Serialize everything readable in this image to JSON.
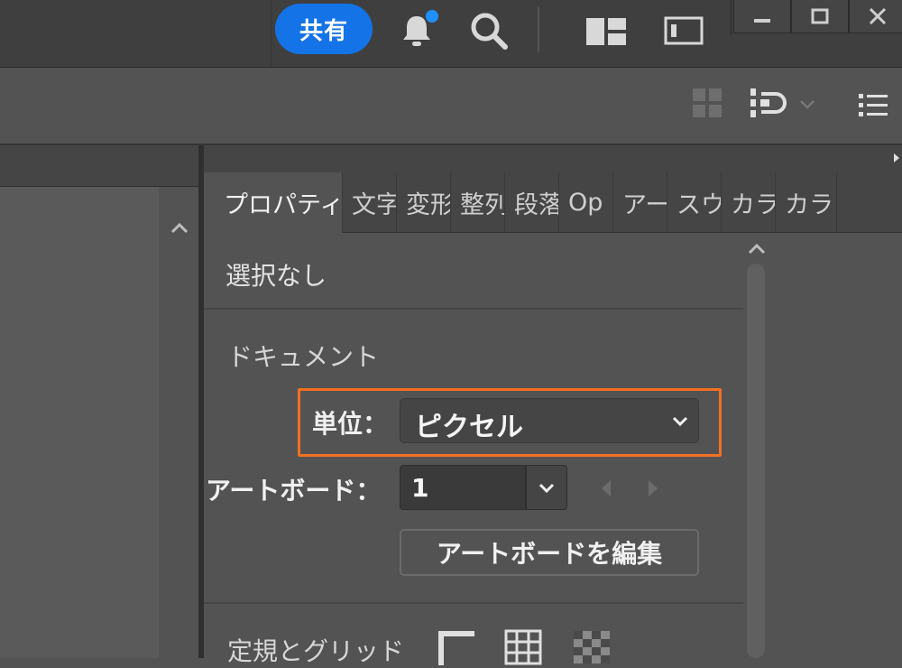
{
  "titlebar": {
    "share_label": "共有",
    "icons": [
      "bell-icon",
      "search-icon",
      "workspace-layout-icon",
      "panel-toggle-icon"
    ],
    "window_controls": [
      "minimize-icon",
      "maximize-icon",
      "close-icon"
    ]
  },
  "optionsbar": {
    "icons": [
      "align-grid-icon",
      "arrange-icon",
      "chevron-down-icon",
      "list-icon"
    ]
  },
  "panel": {
    "tabs": [
      {
        "label": "プロパティ",
        "active": true
      },
      {
        "label": "文字"
      },
      {
        "label": "変形"
      },
      {
        "label": "整列"
      },
      {
        "label": "段落"
      },
      {
        "label": "Op"
      },
      {
        "label": "アー"
      },
      {
        "label": "スウ"
      },
      {
        "label": "カラ"
      },
      {
        "label": "カラ"
      }
    ],
    "selection_text": "選択なし",
    "document_title": "ドキュメント",
    "units_label": "単位：",
    "units_value": "ピクセル",
    "artboard_label": "アートボード：",
    "artboard_value": "1",
    "edit_artboard_button": "アートボードを編集",
    "ruler_grid_title": "定規とグリッド"
  },
  "colors": {
    "accent": "#1473e6",
    "highlight": "#f37021",
    "panel_bg": "#535353",
    "tab_bg": "#454545"
  }
}
